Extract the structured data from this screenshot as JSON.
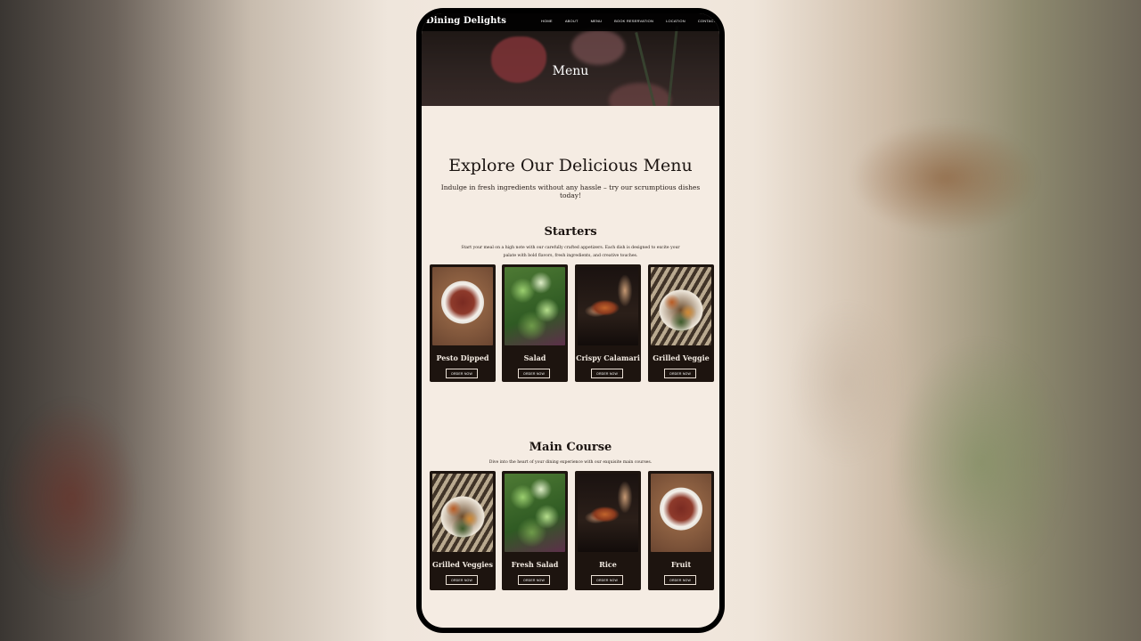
{
  "site": {
    "brand": "Dining Delights",
    "nav": [
      "HOME",
      "ABOUT",
      "MENU",
      "BOOK RESERVATION",
      "LOCATION",
      "CONTACT"
    ]
  },
  "hero": {
    "title": "Menu"
  },
  "intro": {
    "heading": "Explore Our Delicious Menu",
    "subheading": "Indulge in fresh ingredients without any hassle – try our scrumptious dishes today!"
  },
  "starters": {
    "title": "Starters",
    "description": "Start your meal on a high note with our carefully crafted appetizers. Each dish is designed to excite your palate with bold flavors, fresh ingredients, and creative touches.",
    "items": [
      {
        "name": "Pesto Dipped",
        "button": "ORDER NOW",
        "image": "bowl"
      },
      {
        "name": "Salad",
        "button": "ORDER NOW",
        "image": "salad"
      },
      {
        "name": "Crispy Calamari",
        "button": "ORDER NOW",
        "image": "calamari"
      },
      {
        "name": "Grilled Veggie",
        "button": "ORDER NOW",
        "image": "veggie"
      }
    ]
  },
  "main_course": {
    "title": "Main Course",
    "description": "Dive into the heart of your dining experience with our exquisite main courses.",
    "items": [
      {
        "name": "Grilled Veggies",
        "button": "ORDER NOW",
        "image": "veggie"
      },
      {
        "name": "Fresh Salad",
        "button": "ORDER NOW",
        "image": "salad"
      },
      {
        "name": "Rice",
        "button": "ORDER NOW",
        "image": "calamari"
      },
      {
        "name": "Fruit",
        "button": "ORDER NOW",
        "image": "bowl"
      }
    ]
  }
}
